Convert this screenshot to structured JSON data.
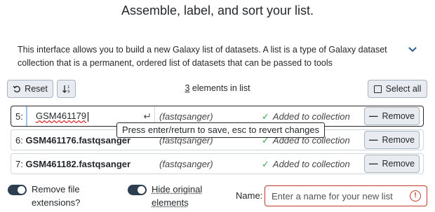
{
  "header": {
    "title": "Assemble, label, and sort your list."
  },
  "description": {
    "text": "This interface allows you to build a new Galaxy list of datasets. A list is a type of Galaxy dataset collection that is a permanent, ordered list of datasets that can be passed to tools"
  },
  "toolbar": {
    "reset_label": "Reset",
    "sort_icon": "sort-numeric-icon",
    "count_number": "3",
    "count_suffix": " elements in list",
    "select_all_label": "Select all"
  },
  "rows": [
    {
      "index": "5:",
      "input_value": "GSM461179",
      "ext": "(fastqsanger)",
      "status": "Added to collection",
      "remove_label": "Remove",
      "tooltip": "Press enter/return to save, esc to revert changes"
    },
    {
      "index": "6:",
      "name": "GSM461176.fastqsanger",
      "ext": "(fastqsanger)",
      "status": "Added to collection",
      "remove_label": "Remove"
    },
    {
      "index": "7:",
      "name": "GSM461182.fastqsanger",
      "ext": "(fastqsanger)",
      "status": "Added to collection",
      "remove_label": "Remove"
    }
  ],
  "options": {
    "remove_extensions_line1": "Remove file",
    "remove_extensions_line2": "extensions?",
    "hide_original_line1": "Hide original",
    "hide_original_line2": "elements"
  },
  "name_field": {
    "label": "Name:",
    "placeholder": "Enter a name for your new list"
  },
  "colors": {
    "accent_dark": "#2c3e50",
    "success": "#3aa648",
    "error": "#c0392b"
  }
}
